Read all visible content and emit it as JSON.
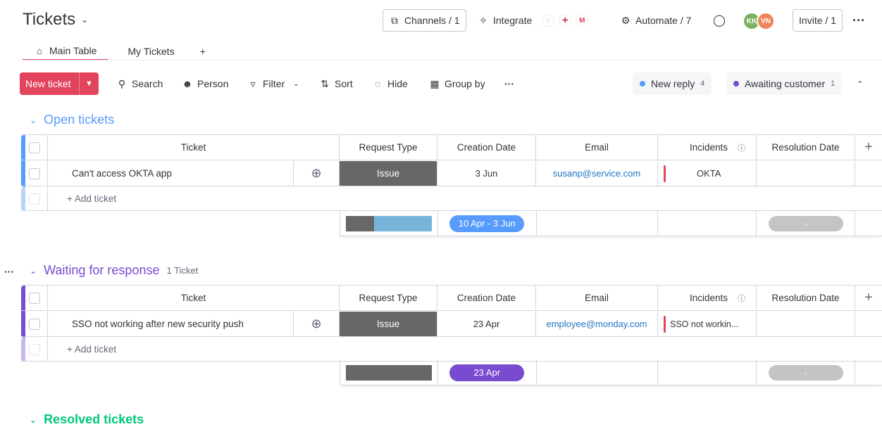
{
  "header": {
    "title": "Tickets",
    "channels_label": "Channels / 1",
    "integrate_label": "Integrate",
    "automate_label": "Automate / 7",
    "invite_label": "Invite / 1",
    "avatars": [
      {
        "initials": "KK",
        "color": "#7cb15f"
      },
      {
        "initials": "VN",
        "color": "#f0845c"
      }
    ]
  },
  "tabs": [
    {
      "label": "Main Table",
      "active": true
    },
    {
      "label": "My Tickets",
      "active": false
    }
  ],
  "toolbar": {
    "new_ticket": "New ticket",
    "search": "Search",
    "person": "Person",
    "filter": "Filter",
    "sort": "Sort",
    "hide": "Hide",
    "group_by": "Group by",
    "pills": [
      {
        "label": "New reply",
        "count": "4",
        "color": "#579bfc"
      },
      {
        "label": "Awaiting customer",
        "count": "1",
        "color": "#784bd1"
      }
    ]
  },
  "columns": {
    "ticket": "Ticket",
    "request_type": "Request Type",
    "creation_date": "Creation Date",
    "email": "Email",
    "incidents": "Incidents",
    "resolution_date": "Resolution Date"
  },
  "groups": [
    {
      "name": "Open tickets",
      "color": "#579bfc",
      "count": "",
      "rows": [
        {
          "ticket": "Can't access OKTA app",
          "request_type": "Issue",
          "creation_date": "3 Jun",
          "email": "susanp@service.com",
          "incident": "OKTA"
        }
      ],
      "add_label": "+ Add ticket",
      "summary_date": "10 Apr - 3 Jun",
      "summary_resolution": "-"
    },
    {
      "name": "Waiting for response",
      "color": "#784bd1",
      "count": "1 Ticket",
      "rows": [
        {
          "ticket": "SSO not working after new security push",
          "request_type": "Issue",
          "creation_date": "23 Apr",
          "email": "employee@monday.com",
          "incident": "SSO not workin..."
        }
      ],
      "add_label": "+ Add ticket",
      "summary_date": "23 Apr",
      "summary_resolution": "-"
    },
    {
      "name": "Resolved tickets",
      "color": "#00c875"
    }
  ]
}
